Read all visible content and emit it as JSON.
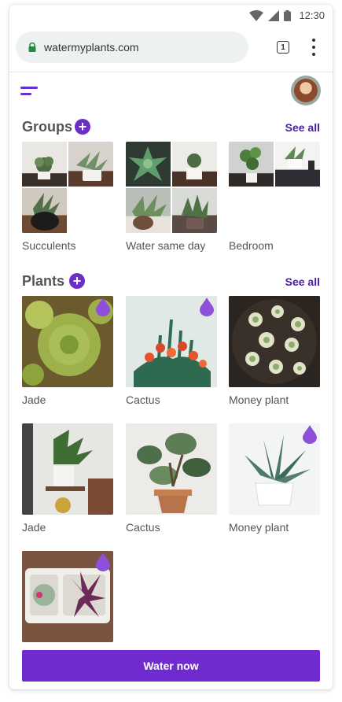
{
  "status_bar": {
    "time": "12:30",
    "icons": [
      "wifi-icon",
      "cell-signal-icon",
      "battery-icon"
    ]
  },
  "browser": {
    "url": "watermyplants.com",
    "tab_count": "1"
  },
  "groups": {
    "title": "Groups",
    "see_all": "See all",
    "items": [
      {
        "name": "Succulents"
      },
      {
        "name": "Water same day"
      },
      {
        "name": "Bedroom"
      }
    ]
  },
  "plants": {
    "title": "Plants",
    "see_all": "See all",
    "items": [
      {
        "name": "Jade",
        "needs_water": true
      },
      {
        "name": "Cactus",
        "needs_water": true
      },
      {
        "name": "Money plant",
        "needs_water": false
      },
      {
        "name": "Jade",
        "needs_water": false
      },
      {
        "name": "Cactus",
        "needs_water": false
      },
      {
        "name": "Money plant",
        "needs_water": true
      },
      {
        "name": "",
        "needs_water": true
      }
    ]
  },
  "actions": {
    "water_now": "Water now"
  },
  "colors": {
    "accent": "#6b2fc7",
    "link": "#4a1fa0",
    "drop": "#8e4fd9"
  }
}
